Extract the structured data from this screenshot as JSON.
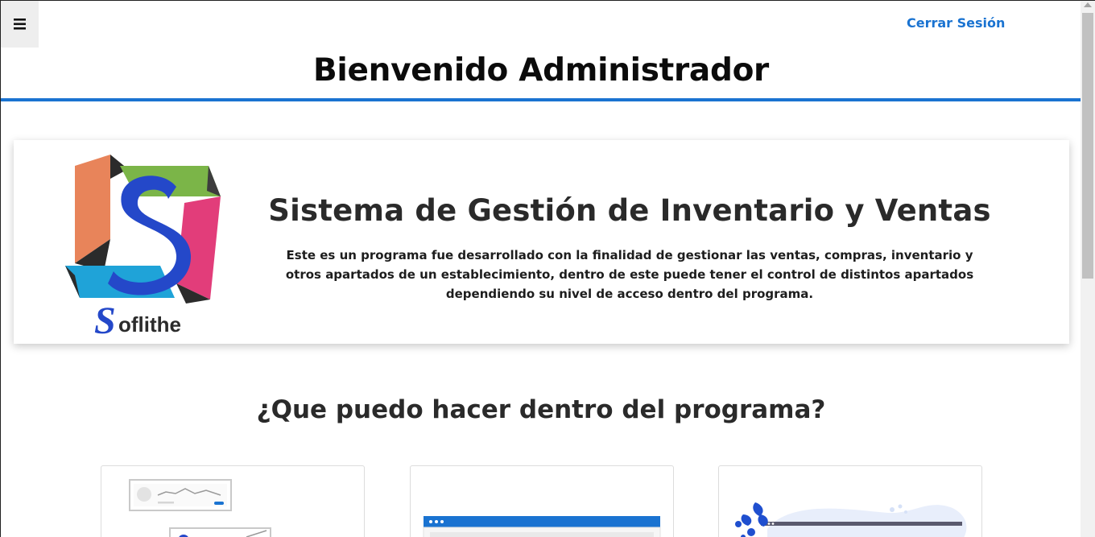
{
  "header": {
    "menu_icon": "hamburger-icon",
    "logout_label": "Cerrar Sesión",
    "page_title": "Bienvenido Administrador",
    "accent_color": "#1a73d1"
  },
  "hero": {
    "logo_text": "Soflithe",
    "heading": "Sistema de Gestión de Inventario y Ventas",
    "description": "Este es un programa fue desarrollado con la finalidad de gestionar las ventas, compras, inventario y otros apartados de un establecimiento, dentro de este puede tener el control de distintos apartados dependiendo su nivel de acceso dentro del programa."
  },
  "features": {
    "heading": "¿Que puedo hacer dentro del programa?",
    "cards": [
      {
        "illustration": "dashboard-chart-illustration"
      },
      {
        "illustration": "browser-window-illustration"
      },
      {
        "illustration": "data-splash-illustration"
      }
    ]
  }
}
